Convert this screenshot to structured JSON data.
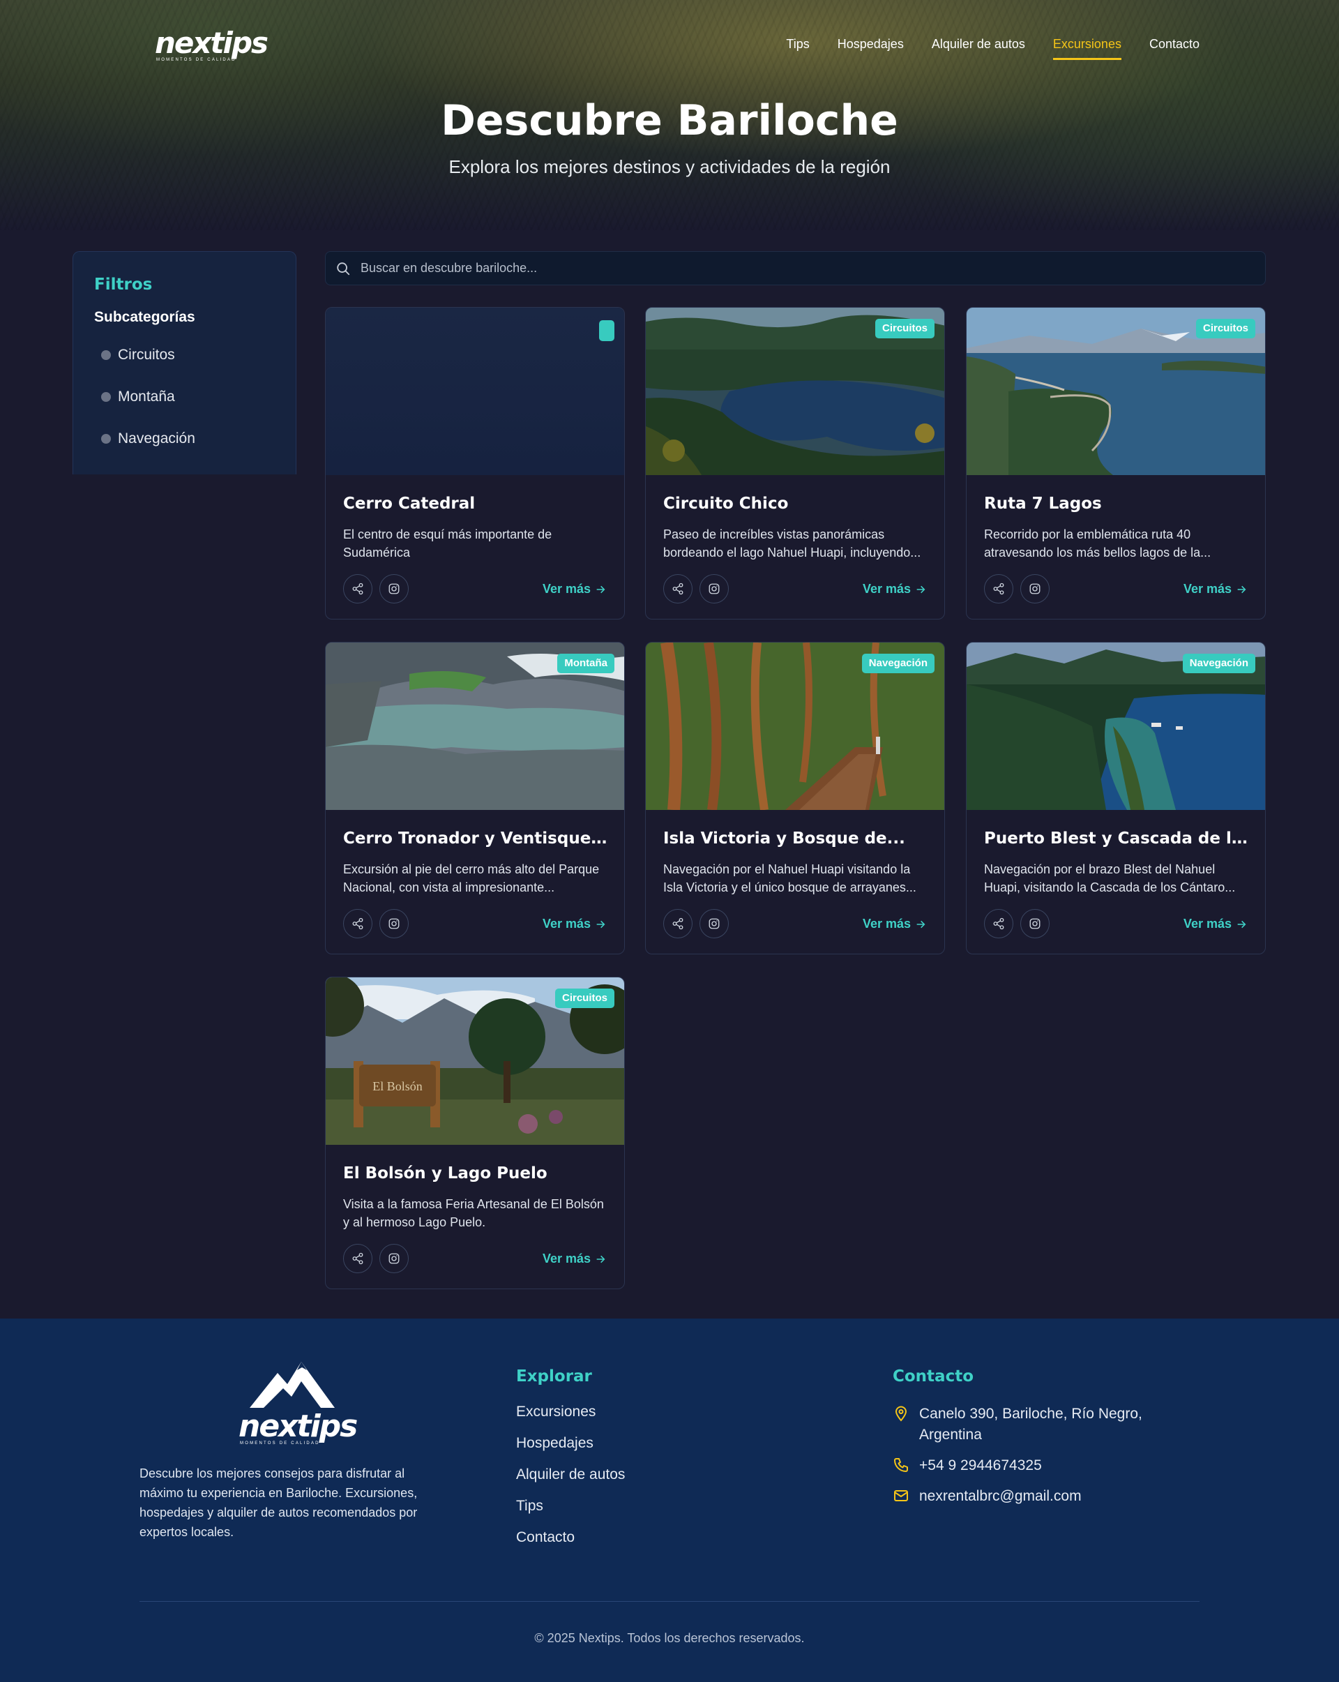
{
  "brand": {
    "name": "nextips",
    "tagline": "MOMENTOS DE CALIDAD"
  },
  "nav": {
    "items": [
      {
        "label": "Tips",
        "active": false
      },
      {
        "label": "Hospedajes",
        "active": false
      },
      {
        "label": "Alquiler de autos",
        "active": false
      },
      {
        "label": "Excursiones",
        "active": true
      },
      {
        "label": "Contacto",
        "active": false
      }
    ]
  },
  "hero": {
    "title": "Descubre Bariloche",
    "subtitle": "Explora los mejores destinos y actividades de la región"
  },
  "filters": {
    "title": "Filtros",
    "subcategories_title": "Subcategorías",
    "items": [
      "Circuitos",
      "Montaña",
      "Navegación"
    ]
  },
  "search": {
    "placeholder": "Buscar en descubre bariloche..."
  },
  "cards": [
    {
      "title": "Cerro Catedral",
      "description": "El centro de esquí más importante de Sudamérica",
      "badge": "",
      "link": "Ver más"
    },
    {
      "title": "Circuito Chico",
      "description": "Paseo de increíbles vistas panorámicas bordeando el lago Nahuel Huapi, incluyendo...",
      "badge": "Circuitos",
      "link": "Ver más"
    },
    {
      "title": "Ruta 7 Lagos",
      "description": "Recorrido por la emblemática ruta 40 atravesando los más bellos lagos de la...",
      "badge": "Circuitos",
      "link": "Ver más"
    },
    {
      "title": "Cerro Tronador y Ventisquero...",
      "description": "Excursión al pie del cerro más alto del Parque Nacional, con vista al impresionante...",
      "badge": "Montaña",
      "link": "Ver más"
    },
    {
      "title": "Isla Victoria y Bosque de...",
      "description": "Navegación por el Nahuel Huapi visitando la Isla Victoria y el único bosque de arrayanes...",
      "badge": "Navegación",
      "link": "Ver más"
    },
    {
      "title": "Puerto Blest y Cascada de los...",
      "description": "Navegación por el brazo Blest del Nahuel Huapi, visitando la Cascada de los Cántaro...",
      "badge": "Navegación",
      "link": "Ver más"
    },
    {
      "title": "El Bolsón y Lago Puelo",
      "description": "Visita a la famosa Feria Artesanal de El Bolsón y al hermoso Lago Puelo.",
      "badge": "Circuitos",
      "link": "Ver más",
      "sign_text": "El Bolsón"
    }
  ],
  "footer": {
    "about": "Descubre los mejores consejos para disfrutar al máximo tu experiencia en Bariloche. Excursiones, hospedajes y alquiler de autos recomendados por expertos locales.",
    "explore_title": "Explorar",
    "explore_links": [
      "Excursiones",
      "Hospedajes",
      "Alquiler de autos",
      "Tips",
      "Contacto"
    ],
    "contact_title": "Contacto",
    "address": "Canelo 390, Bariloche, Río Negro, Argentina",
    "phone": "+54 9 2944674325",
    "email": "nexrentalbrc@gmail.com",
    "copyright": "© 2025 Nextips. Todos los derechos reservados."
  },
  "colors": {
    "background": "#1a1a2e",
    "accent_teal": "#3fd1c7",
    "accent_yellow": "#f5c518",
    "footer_bg": "#0f2a55",
    "sidebar_bg": "#16233f"
  },
  "icons": [
    "search-icon",
    "share-icon",
    "instagram-icon",
    "arrow-right-icon",
    "location-pin-icon",
    "phone-icon",
    "mail-icon",
    "mountain-logo-icon"
  ]
}
